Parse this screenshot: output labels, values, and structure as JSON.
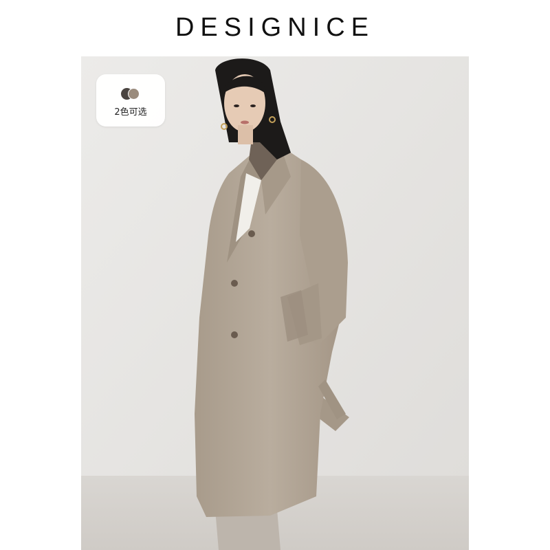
{
  "brand": {
    "name": "DESIGNICE"
  },
  "badge": {
    "label": "2色可选",
    "swatch_colors": [
      "#4a4440",
      "#9a8b7c"
    ]
  },
  "photo": {
    "subject": "model-in-camel-wool-coat",
    "background_color": "#e8e7e5",
    "coat_color": "#b2a595"
  }
}
